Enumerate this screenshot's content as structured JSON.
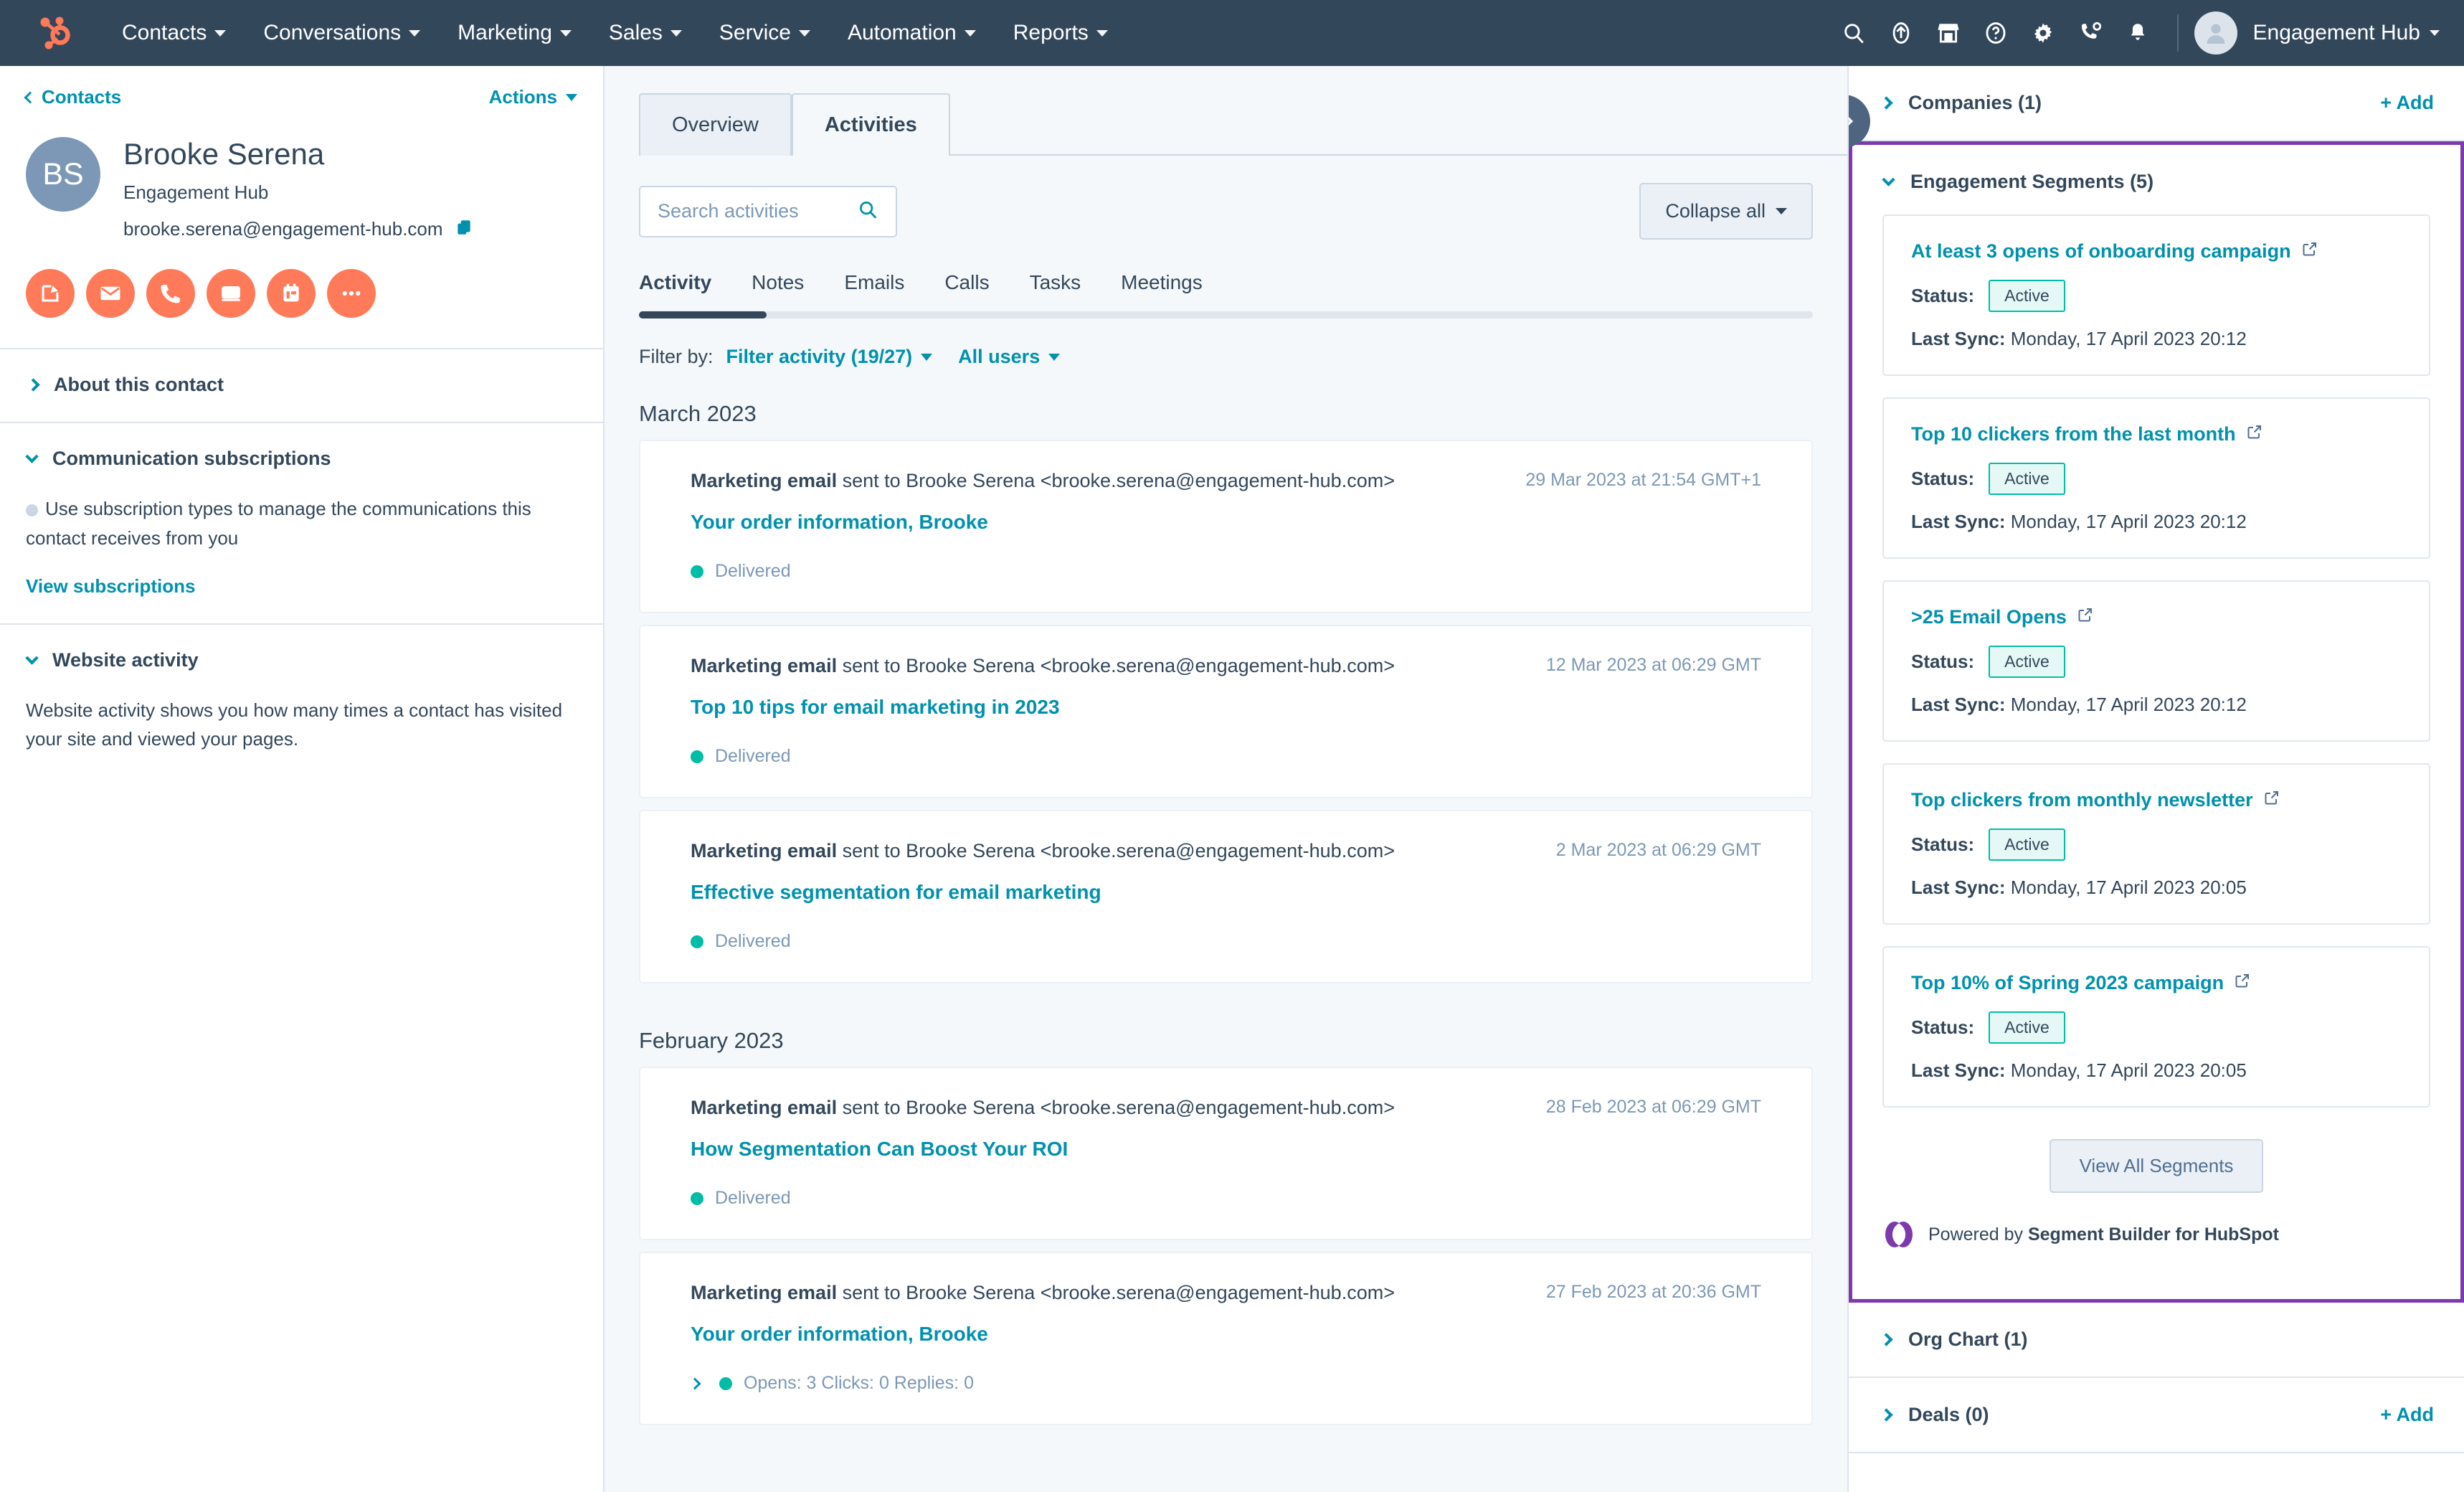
{
  "topnav": {
    "logo_icon": "hubspot-sprocket-logo",
    "menu": [
      {
        "label": "Contacts",
        "icon": "chevron-down-icon"
      },
      {
        "label": "Conversations",
        "icon": "chevron-down-icon"
      },
      {
        "label": "Marketing",
        "icon": "chevron-down-icon"
      },
      {
        "label": "Sales",
        "icon": "chevron-down-icon"
      },
      {
        "label": "Service",
        "icon": "chevron-down-icon"
      },
      {
        "label": "Automation",
        "icon": "chevron-down-icon"
      },
      {
        "label": "Reports",
        "icon": "chevron-down-icon"
      }
    ],
    "icons": [
      "search-icon",
      "upgrade-arrow-icon",
      "marketplace-storefront-icon",
      "help-question-icon",
      "gear-icon",
      "calling-phone-icon",
      "notifications-bell-icon"
    ],
    "account_name": "Engagement Hub",
    "avatar_icon": "user-avatar-icon"
  },
  "left_panel": {
    "breadcrumb": "Contacts",
    "back_icon": "chevron-left-icon",
    "actions_label": "Actions",
    "avatar_initials": "BS",
    "contact_name": "Brooke Serena",
    "company": "Engagement Hub",
    "email": "brooke.serena@engagement-hub.com",
    "copy_icon": "copy-icon",
    "action_buttons": [
      {
        "name": "note-icon",
        "label": "Note"
      },
      {
        "name": "email-icon",
        "label": "Email"
      },
      {
        "name": "call-icon",
        "label": "Call"
      },
      {
        "name": "log-icon",
        "label": "Log"
      },
      {
        "name": "task-icon",
        "label": "Task"
      },
      {
        "name": "more-ellipsis-icon",
        "label": "More"
      }
    ],
    "sections": [
      {
        "title": "About this contact",
        "expanded": false
      },
      {
        "title": "Communication subscriptions",
        "expanded": true,
        "body": "Use subscription types to manage the communications this contact receives from you",
        "link": "View subscriptions"
      },
      {
        "title": "Website activity",
        "expanded": true,
        "body": "Website activity shows you how many times a contact has visited your site and viewed your pages."
      }
    ]
  },
  "main": {
    "tabs": [
      {
        "label": "Overview",
        "active": false
      },
      {
        "label": "Activities",
        "active": true
      }
    ],
    "search": {
      "placeholder": "Search activities",
      "icon": "search-icon"
    },
    "collapse_all_label": "Collapse all",
    "subtabs": [
      {
        "label": "Activity",
        "active": true
      },
      {
        "label": "Notes",
        "active": false
      },
      {
        "label": "Emails",
        "active": false
      },
      {
        "label": "Calls",
        "active": false
      },
      {
        "label": "Tasks",
        "active": false
      },
      {
        "label": "Meetings",
        "active": false
      }
    ],
    "filter_prefix": "Filter by:",
    "filter_activity": "Filter activity (19/27)",
    "filter_users": "All users",
    "groups": [
      {
        "month": "March 2023",
        "items": [
          {
            "type": "Marketing email",
            "desc": " sent to Brooke Serena <brooke.serena@engagement-hub.com>",
            "timestamp": "29 Mar 2023 at 21:54 GMT+1",
            "subject": "Your order information, Brooke",
            "status": "Delivered",
            "expandable": false
          },
          {
            "type": "Marketing email",
            "desc": " sent to Brooke Serena <brooke.serena@engagement-hub.com>",
            "timestamp": "12 Mar 2023 at 06:29 GMT",
            "subject": "Top 10 tips for email marketing in 2023",
            "status": "Delivered",
            "expandable": false
          },
          {
            "type": "Marketing email",
            "desc": " sent to Brooke Serena <brooke.serena@engagement-hub.com>",
            "timestamp": "2 Mar 2023 at 06:29 GMT",
            "subject": "Effective segmentation for email marketing",
            "status": "Delivered",
            "expandable": false
          }
        ]
      },
      {
        "month": "February 2023",
        "items": [
          {
            "type": "Marketing email",
            "desc": " sent to Brooke Serena <brooke.serena@engagement-hub.com>",
            "timestamp": "28 Feb 2023 at 06:29 GMT",
            "subject": "How Segmentation Can Boost Your ROI",
            "status": "Delivered",
            "expandable": false
          },
          {
            "type": "Marketing email",
            "desc": " sent to Brooke Serena <brooke.serena@engagement-hub.com>",
            "timestamp": "27 Feb 2023 at 20:36 GMT",
            "subject": "Your order information, Brooke",
            "status": "Opens: 3    Clicks: 0    Replies: 0",
            "expandable": true
          }
        ]
      }
    ]
  },
  "right_panel": {
    "collapse_handle_icon": "double-chevron-right-icon",
    "companies": {
      "title": "Companies (1)",
      "add_label": "+ Add"
    },
    "segments": {
      "title": "Engagement Segments (5)",
      "status_label": "Status:",
      "sync_label": "Last Sync:",
      "cards": [
        {
          "name": "At least 3 opens of onboarding campaign",
          "status": "Active",
          "last_sync": "Monday, 17 April 2023 20:12"
        },
        {
          "name": "Top 10 clickers from the last month",
          "status": "Active",
          "last_sync": "Monday, 17 April 2023 20:12"
        },
        {
          "name": ">25 Email Opens",
          "status": "Active",
          "last_sync": "Monday, 17 April 2023 20:12"
        },
        {
          "name": "Top clickers from monthly newsletter",
          "status": "Active",
          "last_sync": "Monday, 17 April 2023 20:05"
        },
        {
          "name": "Top 10% of Spring 2023 campaign",
          "status": "Active",
          "last_sync": "Monday, 17 April 2023 20:05"
        }
      ],
      "view_all_label": "View All Segments",
      "powered_prefix": "Powered by ",
      "powered_brand": "Segment Builder for HubSpot",
      "brand_color": "#7c3aad",
      "external_link_icon": "external-link-icon"
    },
    "org_chart": {
      "title": "Org Chart (1)"
    },
    "deals": {
      "title": "Deals (0)",
      "add_label": "+ Add"
    }
  },
  "colors": {
    "nav_bg": "#33475b",
    "accent_orange": "#ff7a59",
    "link_teal": "#0091ae",
    "status_green": "#00bda5",
    "highlight_purple": "#7c3aad",
    "page_bg": "#f5f8fa"
  }
}
